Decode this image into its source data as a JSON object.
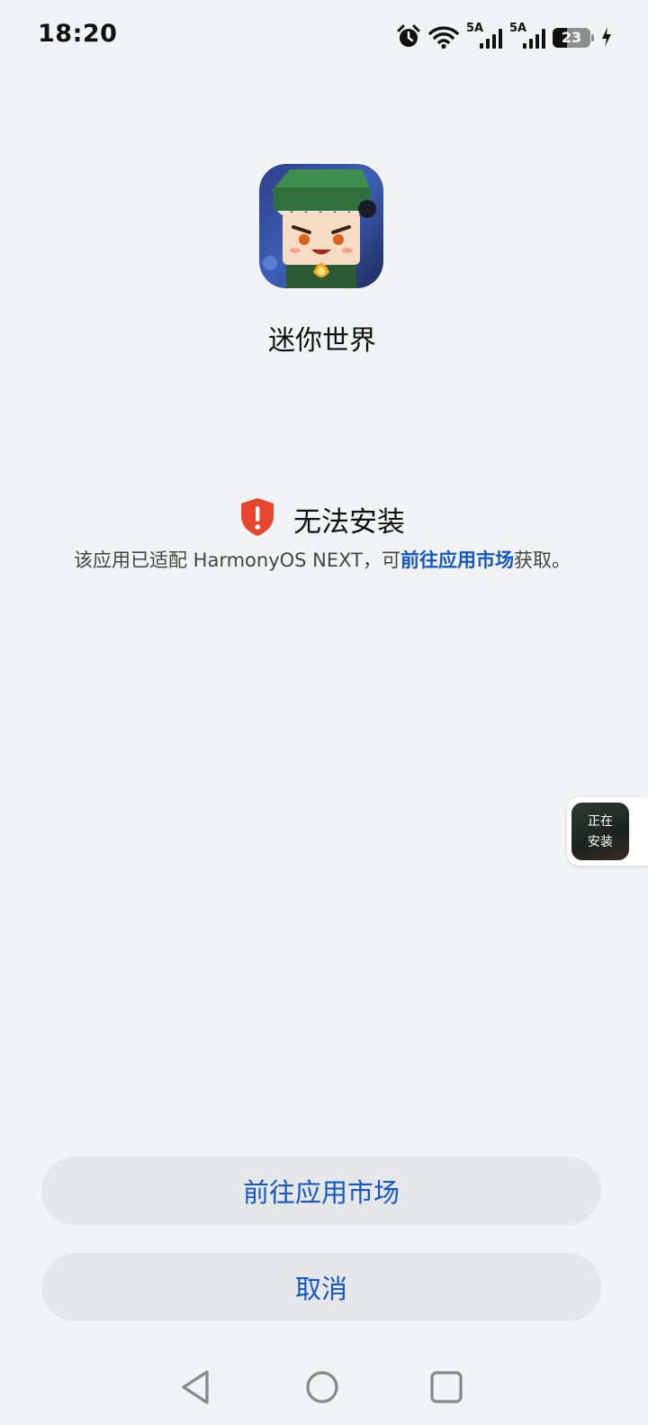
{
  "status_bar": {
    "time": "18:20",
    "network_1_label": "5A",
    "network_2_label": "5A",
    "battery_level": "23",
    "icons": [
      "alarm-icon",
      "wifi-icon",
      "signal-icon",
      "signal-icon",
      "battery-icon",
      "charging-icon"
    ]
  },
  "app": {
    "name": "迷你世界",
    "icon": "mini-world-app-icon"
  },
  "warning": {
    "icon": "shield-alert-icon",
    "title": "无法安装",
    "desc_prefix": "该应用已适配 HarmonyOS NEXT，可",
    "desc_link": "前往应用市场",
    "desc_suffix": "获取。"
  },
  "floating_install": {
    "line1": "正在",
    "line2": "安装"
  },
  "buttons": {
    "market_label": "前往应用市场",
    "cancel_label": "取消"
  },
  "nav": {
    "icons": [
      "back-icon",
      "home-icon",
      "recent-apps-icon"
    ]
  },
  "colors": {
    "background": "#f1f3f5",
    "accent": "#1457c7",
    "warning_red": "#e8452f",
    "button_bg": "#e6e7e9"
  }
}
